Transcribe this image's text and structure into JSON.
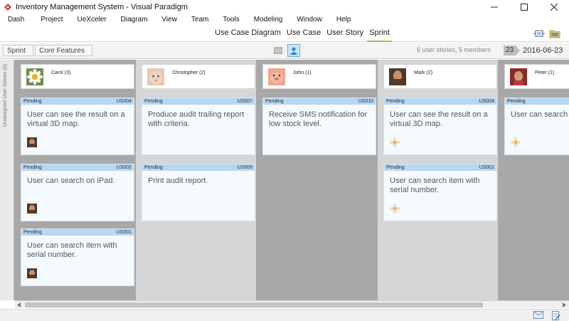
{
  "window": {
    "title": "Inventory Management System - Visual Paradigm"
  },
  "menu": [
    "Dash",
    "Project",
    "UeXceler",
    "Diagram",
    "View",
    "Team",
    "Tools",
    "Modeling",
    "Window",
    "Help"
  ],
  "tabs": [
    {
      "label": "Use Case Diagram",
      "active": false
    },
    {
      "label": "Use Case",
      "active": false
    },
    {
      "label": "User Story",
      "active": false
    },
    {
      "label": "Sprint",
      "active": true
    }
  ],
  "breadcrumb": [
    "Sprint",
    "Core Features"
  ],
  "summary": "6 user stories, 5 members",
  "date": {
    "day": "23",
    "value": "2016-06-23"
  },
  "side_label": "Unassigned User Stories (0)",
  "colors": {
    "accent": "#9bc53d",
    "story_header": "#b7d6f3",
    "board": "#a9a9a9"
  },
  "members": [
    {
      "name": "Carol (3)",
      "avatar": "flower-avatar",
      "stories": [
        {
          "status": "Pending",
          "id": "US004",
          "text": "User can see the result on a virtual 3D map.",
          "avatar": "man-avatar"
        },
        {
          "status": "Pending",
          "id": "US002",
          "text": "User can search on iPad.",
          "avatar": "man-avatar"
        },
        {
          "status": "Pending",
          "id": "US001",
          "text": "User can search item with serial number.",
          "avatar": "man-avatar"
        }
      ]
    },
    {
      "name": "Christopher (2)",
      "avatar": "baby-avatar",
      "stories": [
        {
          "status": "Pending",
          "id": "US007",
          "text": "Produce audit trailing report with criteria."
        },
        {
          "status": "Pending",
          "id": "US009",
          "text": "Print audit report."
        }
      ]
    },
    {
      "name": "John (1)",
      "avatar": "piglet-avatar",
      "stories": [
        {
          "status": "Pending",
          "id": "US010",
          "text": "Receive SMS notification for low stock level."
        }
      ]
    },
    {
      "name": "Mark (2)",
      "avatar": "man-avatar",
      "stories": [
        {
          "status": "Pending",
          "id": "US004",
          "text": "User can see the result on a virtual 3D map.",
          "avatar": "flower-avatar"
        },
        {
          "status": "Pending",
          "id": "US001",
          "text": "User can search item with serial number.",
          "avatar": "flower-avatar"
        }
      ]
    },
    {
      "name": "Peter (1)",
      "avatar": "man-red-avatar",
      "stories": [
        {
          "status": "Pending",
          "id": "",
          "text": "User can search on",
          "avatar": "flower-avatar"
        }
      ]
    }
  ]
}
